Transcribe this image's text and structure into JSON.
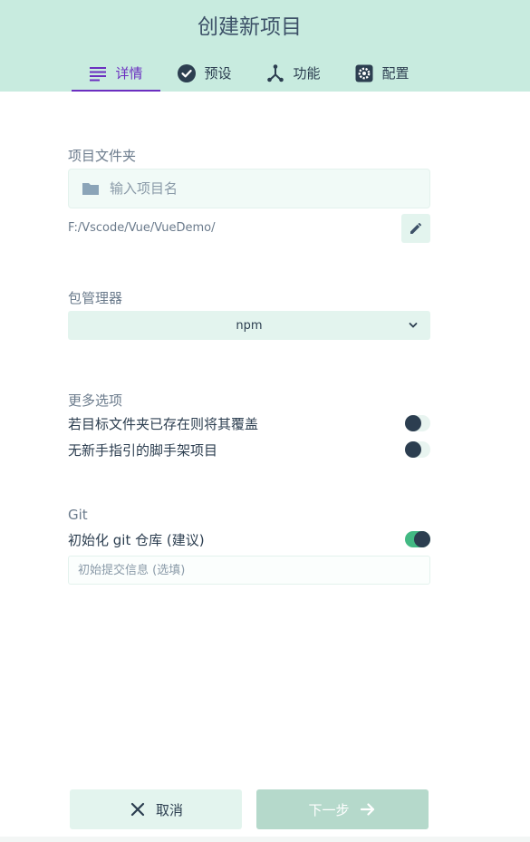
{
  "header": {
    "title": "创建新项目",
    "tabs": [
      {
        "label": "详情",
        "icon": "list-icon",
        "active": true
      },
      {
        "label": "预设",
        "icon": "check-circle-icon",
        "active": false
      },
      {
        "label": "功能",
        "icon": "fork-icon",
        "active": false
      },
      {
        "label": "配置",
        "icon": "gear-icon",
        "active": false
      }
    ]
  },
  "folder": {
    "label": "项目文件夹",
    "placeholder": "输入项目名",
    "path": "F:/Vscode/Vue/VueDemo/"
  },
  "package_manager": {
    "label": "包管理器",
    "selected": "npm"
  },
  "more_options": {
    "label": "更多选项",
    "items": [
      {
        "label": "若目标文件夹已存在则将其覆盖",
        "enabled": false
      },
      {
        "label": "无新手指引的脚手架项目",
        "enabled": false
      }
    ]
  },
  "git": {
    "label": "Git",
    "init_label": "初始化 git 仓库 (建议)",
    "init_enabled": true,
    "commit_placeholder": "初始提交信息 (选填)"
  },
  "footer": {
    "cancel_label": "取消",
    "next_label": "下一步"
  },
  "colors": {
    "header_bg": "#c8ebdf",
    "accent": "#6b2fc0",
    "toggle_on": "#42b983",
    "text": "#2c3e50"
  }
}
